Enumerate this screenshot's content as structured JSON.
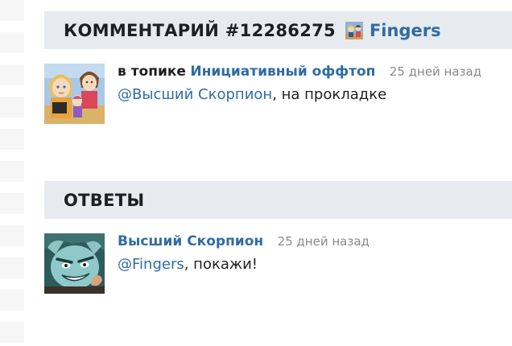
{
  "comment_header": {
    "title": "КОММЕНТАРИЙ #12286275",
    "author": "Fingers"
  },
  "comment": {
    "prefix": "в топике",
    "topic": "Инициативный оффтоп",
    "time": "25 дней назад",
    "mention": "@Высший Скорпион",
    "text": ", на прокладке"
  },
  "replies_header": {
    "title": "ОТВЕТЫ"
  },
  "reply": {
    "author": "Высший Скорпион",
    "time": "25 дней назад",
    "mention": "@Fingers",
    "text": ", покажи!"
  },
  "colors": {
    "link": "#2f6da3",
    "header_bg": "#e7eaee",
    "muted": "#8a8a8a"
  }
}
